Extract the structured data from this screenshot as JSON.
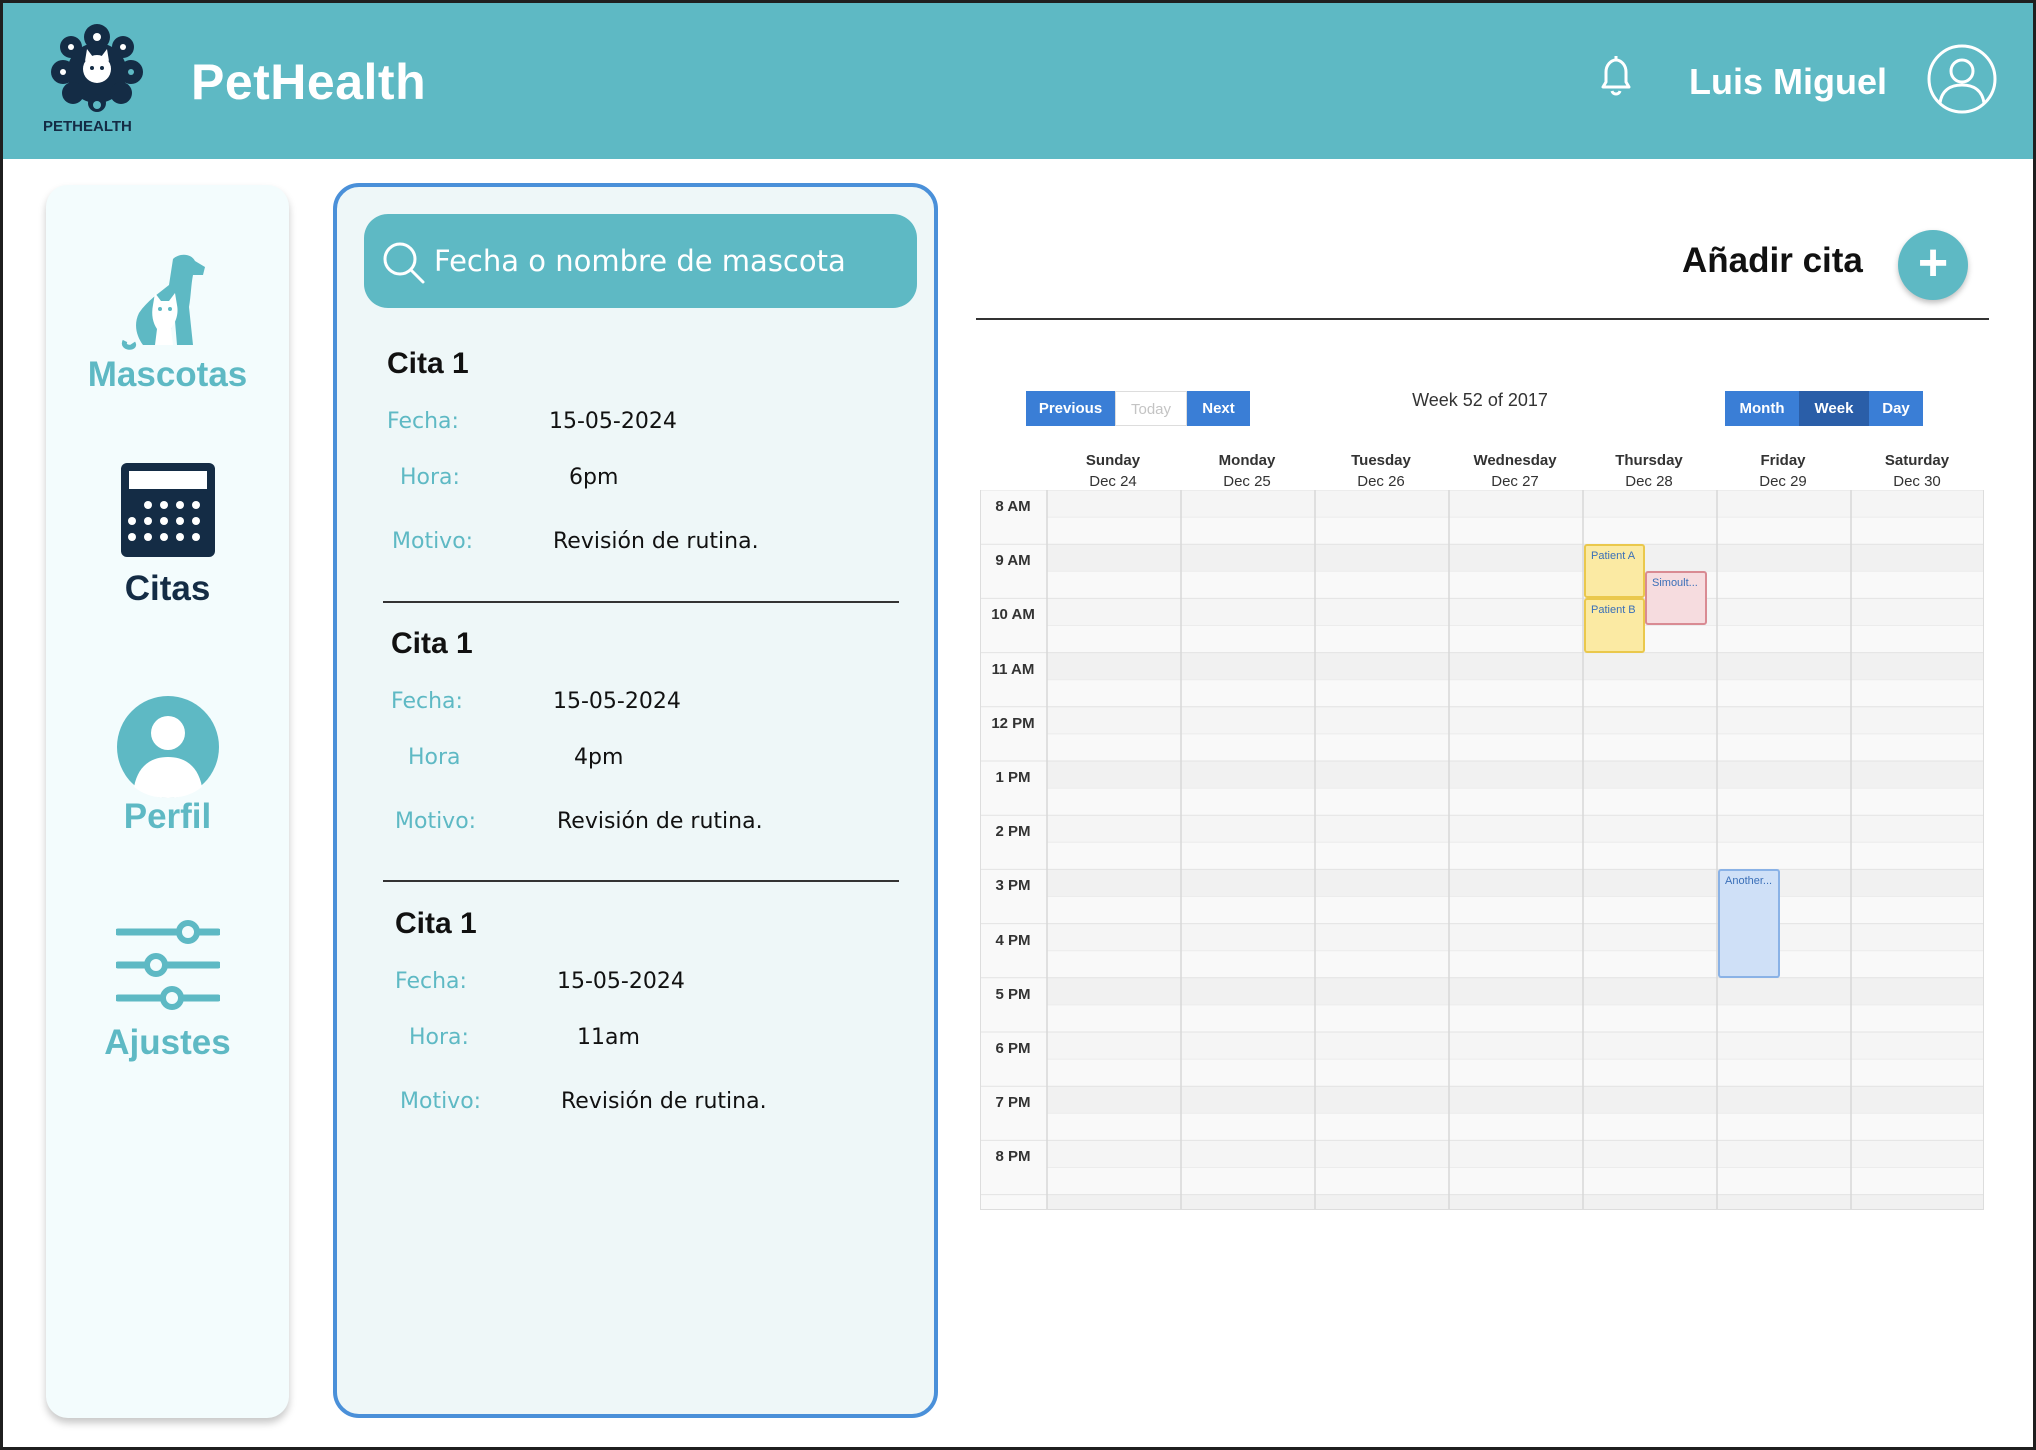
{
  "header": {
    "logo_text": "PETHEALTH",
    "app_title": "PetHealth",
    "user_name": "Luis Miguel",
    "bell_icon": "bell-icon",
    "avatar_icon": "user-circle-icon",
    "background_color": "#5eb9c4"
  },
  "sidebar": {
    "items": [
      {
        "label": "Mascotas",
        "icon": "dog-cat-icon",
        "color": "#5eb9c4"
      },
      {
        "label": "Citas",
        "icon": "calendar-icon",
        "color": "#142c45",
        "active": true
      },
      {
        "label": "Perfil",
        "icon": "profile-icon",
        "color": "#5eb9c4"
      },
      {
        "label": "Ajustes",
        "icon": "sliders-icon",
        "color": "#5eb9c4"
      }
    ]
  },
  "search": {
    "placeholder": "Fecha o nombre de mascota",
    "icon": "search-icon"
  },
  "appointments": [
    {
      "title": "Cita 1",
      "fecha_label": "Fecha:",
      "fecha": "15-05-2024",
      "hora_label": "Hora:",
      "hora": "6pm",
      "motivo_label": "Motivo:",
      "motivo": "Revisión de rutina."
    },
    {
      "title": "Cita 1",
      "fecha_label": "Fecha:",
      "fecha": "15-05-2024",
      "hora_label": "Hora",
      "hora": "4pm",
      "motivo_label": "Motivo:",
      "motivo": "Revisión de rutina."
    },
    {
      "title": "Cita 1",
      "fecha_label": "Fecha:",
      "fecha": "15-05-2024",
      "hora_label": "Hora:",
      "hora": "11am",
      "motivo_label": "Motivo:",
      "motivo": "Revisión de rutina."
    }
  ],
  "calendar": {
    "add_label": "Añadir cita",
    "add_icon": "plus-icon",
    "nav": {
      "previous": "Previous",
      "today": "Today",
      "next": "Next"
    },
    "week_label": "Week 52 of 2017",
    "views": {
      "month": "Month",
      "week": "Week",
      "day": "Day",
      "selected": "Week"
    },
    "days": [
      {
        "name": "Sunday",
        "date": "Dec 24"
      },
      {
        "name": "Monday",
        "date": "Dec 25"
      },
      {
        "name": "Tuesday",
        "date": "Dec 26"
      },
      {
        "name": "Wednesday",
        "date": "Dec 27"
      },
      {
        "name": "Thursday",
        "date": "Dec 28"
      },
      {
        "name": "Friday",
        "date": "Dec 29"
      },
      {
        "name": "Saturday",
        "date": "Dec 30"
      }
    ],
    "hours": [
      "8 AM",
      "9 AM",
      "10 AM",
      "11 AM",
      "12 PM",
      "1 PM",
      "2 PM",
      "3 PM",
      "4 PM",
      "5 PM",
      "6 PM",
      "7 PM",
      "8 PM"
    ],
    "events": [
      {
        "title": "Patient A",
        "day": "Thursday",
        "start": "9 AM",
        "end": "10 AM",
        "color": "yellow"
      },
      {
        "title": "Patient B",
        "day": "Thursday",
        "start": "10 AM",
        "end": "11 AM",
        "color": "yellow"
      },
      {
        "title": "Simoult...",
        "day": "Thursday",
        "start": "9:30 AM",
        "end": "10:30 AM",
        "color": "red"
      },
      {
        "title": "Another...",
        "day": "Friday",
        "start": "3 PM",
        "end": "5 PM",
        "color": "blue"
      }
    ]
  }
}
